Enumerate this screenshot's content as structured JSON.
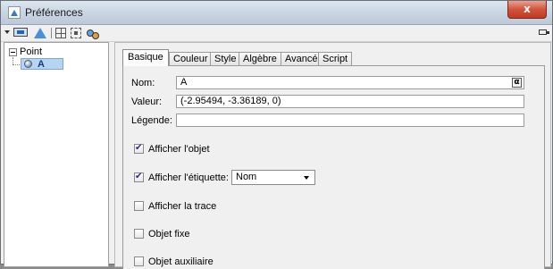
{
  "window": {
    "title": "Préférences",
    "close_label": "x"
  },
  "toolbar": {
    "icons": [
      "dropdown-arrow-icon",
      "object-view-icon",
      "geometry-icon",
      "grid-icon",
      "select-icon",
      "style-icon",
      "dock-icon"
    ]
  },
  "tree": {
    "root_label": "Point",
    "child_label": "A"
  },
  "tabs": [
    {
      "label": "Basique",
      "active": true
    },
    {
      "label": "Couleur"
    },
    {
      "label": "Style"
    },
    {
      "label": "Algèbre"
    },
    {
      "label": "Avancé"
    },
    {
      "label": "Script"
    }
  ],
  "basic": {
    "name_label": "Nom:",
    "name_value": "A",
    "name_button": "α",
    "value_label": "Valeur:",
    "value_value": "(-2.95494, -3.36189, 0)",
    "caption_label": "Légende:",
    "caption_value": "",
    "show_object": {
      "label": "Afficher l'objet",
      "checked": true
    },
    "show_label": {
      "label": "Afficher l'étiquette:",
      "checked": true,
      "option": "Nom"
    },
    "show_trace": {
      "label": "Afficher la trace",
      "checked": false
    },
    "fixed_object": {
      "label": "Objet fixe",
      "checked": false
    },
    "aux_object": {
      "label": "Objet auxiliaire",
      "checked": false
    }
  }
}
